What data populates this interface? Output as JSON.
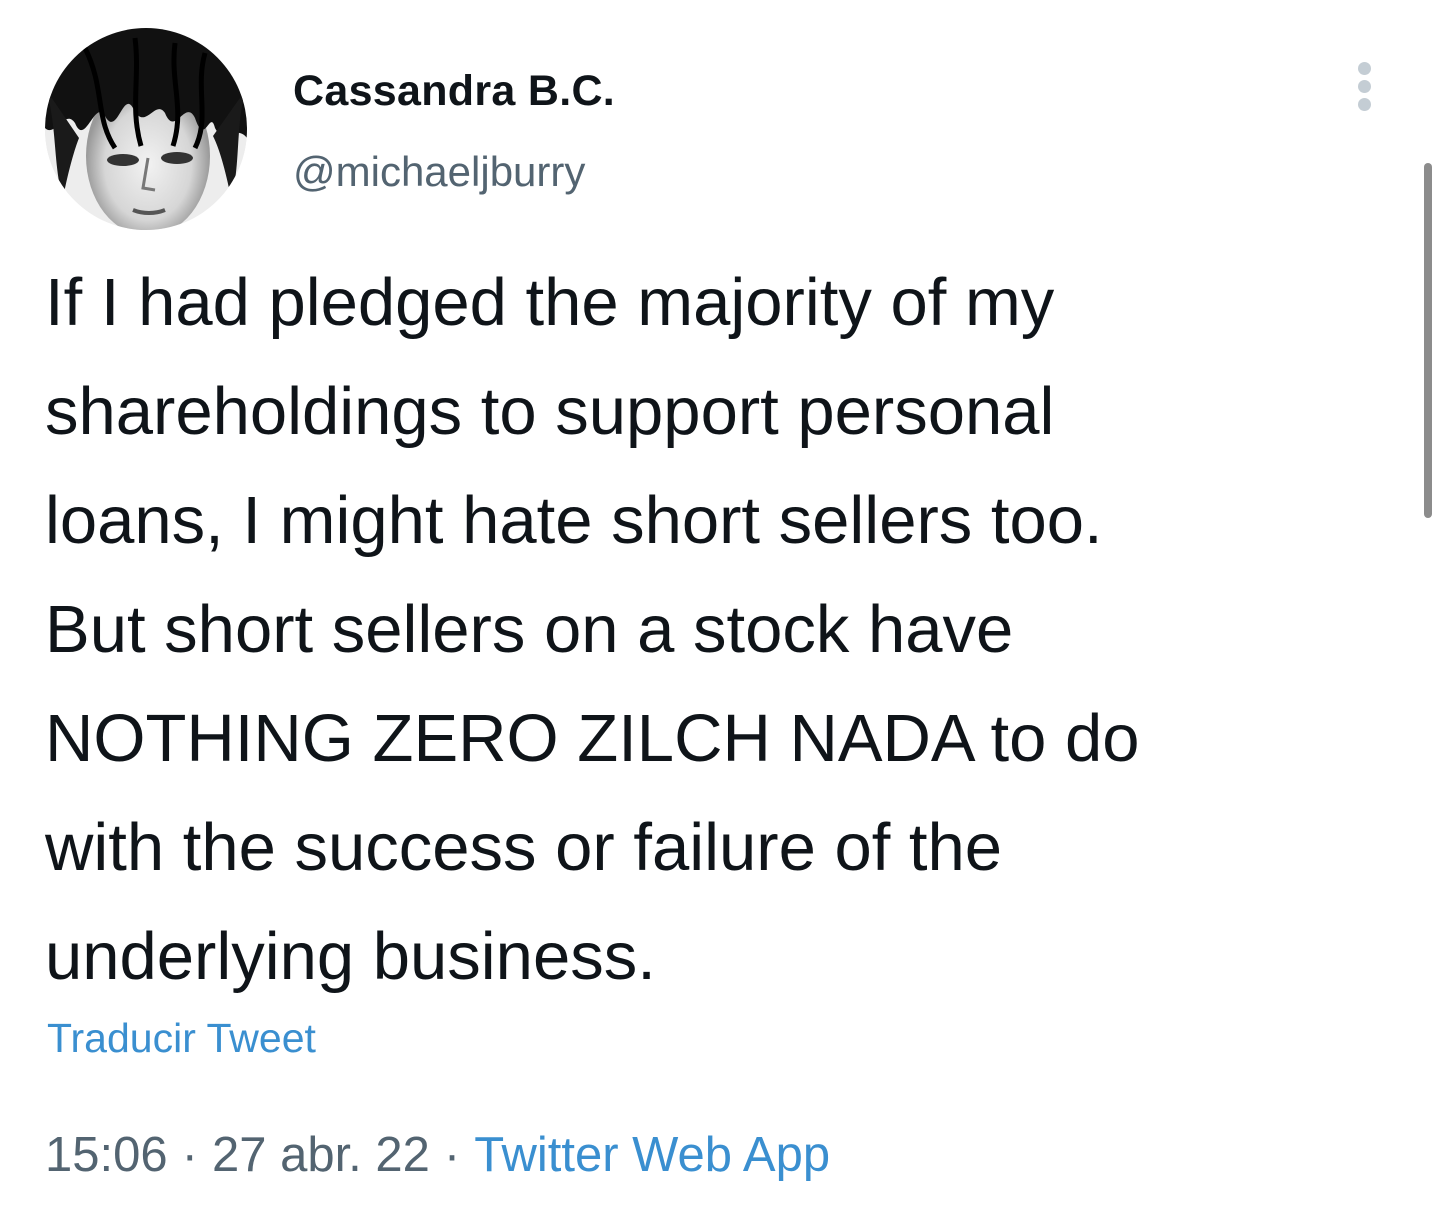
{
  "author": {
    "display_name": "Cassandra B.C.",
    "handle": "@michaeljburry",
    "avatar_icon": "profile-photo"
  },
  "tweet": {
    "lines": [
      "If I had pledged the majority of my",
      "shareholdings to support personal",
      "loans, I might hate short sellers too.",
      "But short sellers on a stock have",
      "NOTHING ZERO ZILCH NADA to do",
      "with the success or failure of the",
      "underlying business."
    ],
    "translate_label": "Traducir Tweet"
  },
  "meta": {
    "time": "15:06",
    "separator": "·",
    "date": "27 abr. 22",
    "source": "Twitter Web App"
  },
  "icons": {
    "more": "more-vertical-icon"
  },
  "colors": {
    "text": "#0f1419",
    "secondary": "#536471",
    "link": "#3a8fd0"
  }
}
